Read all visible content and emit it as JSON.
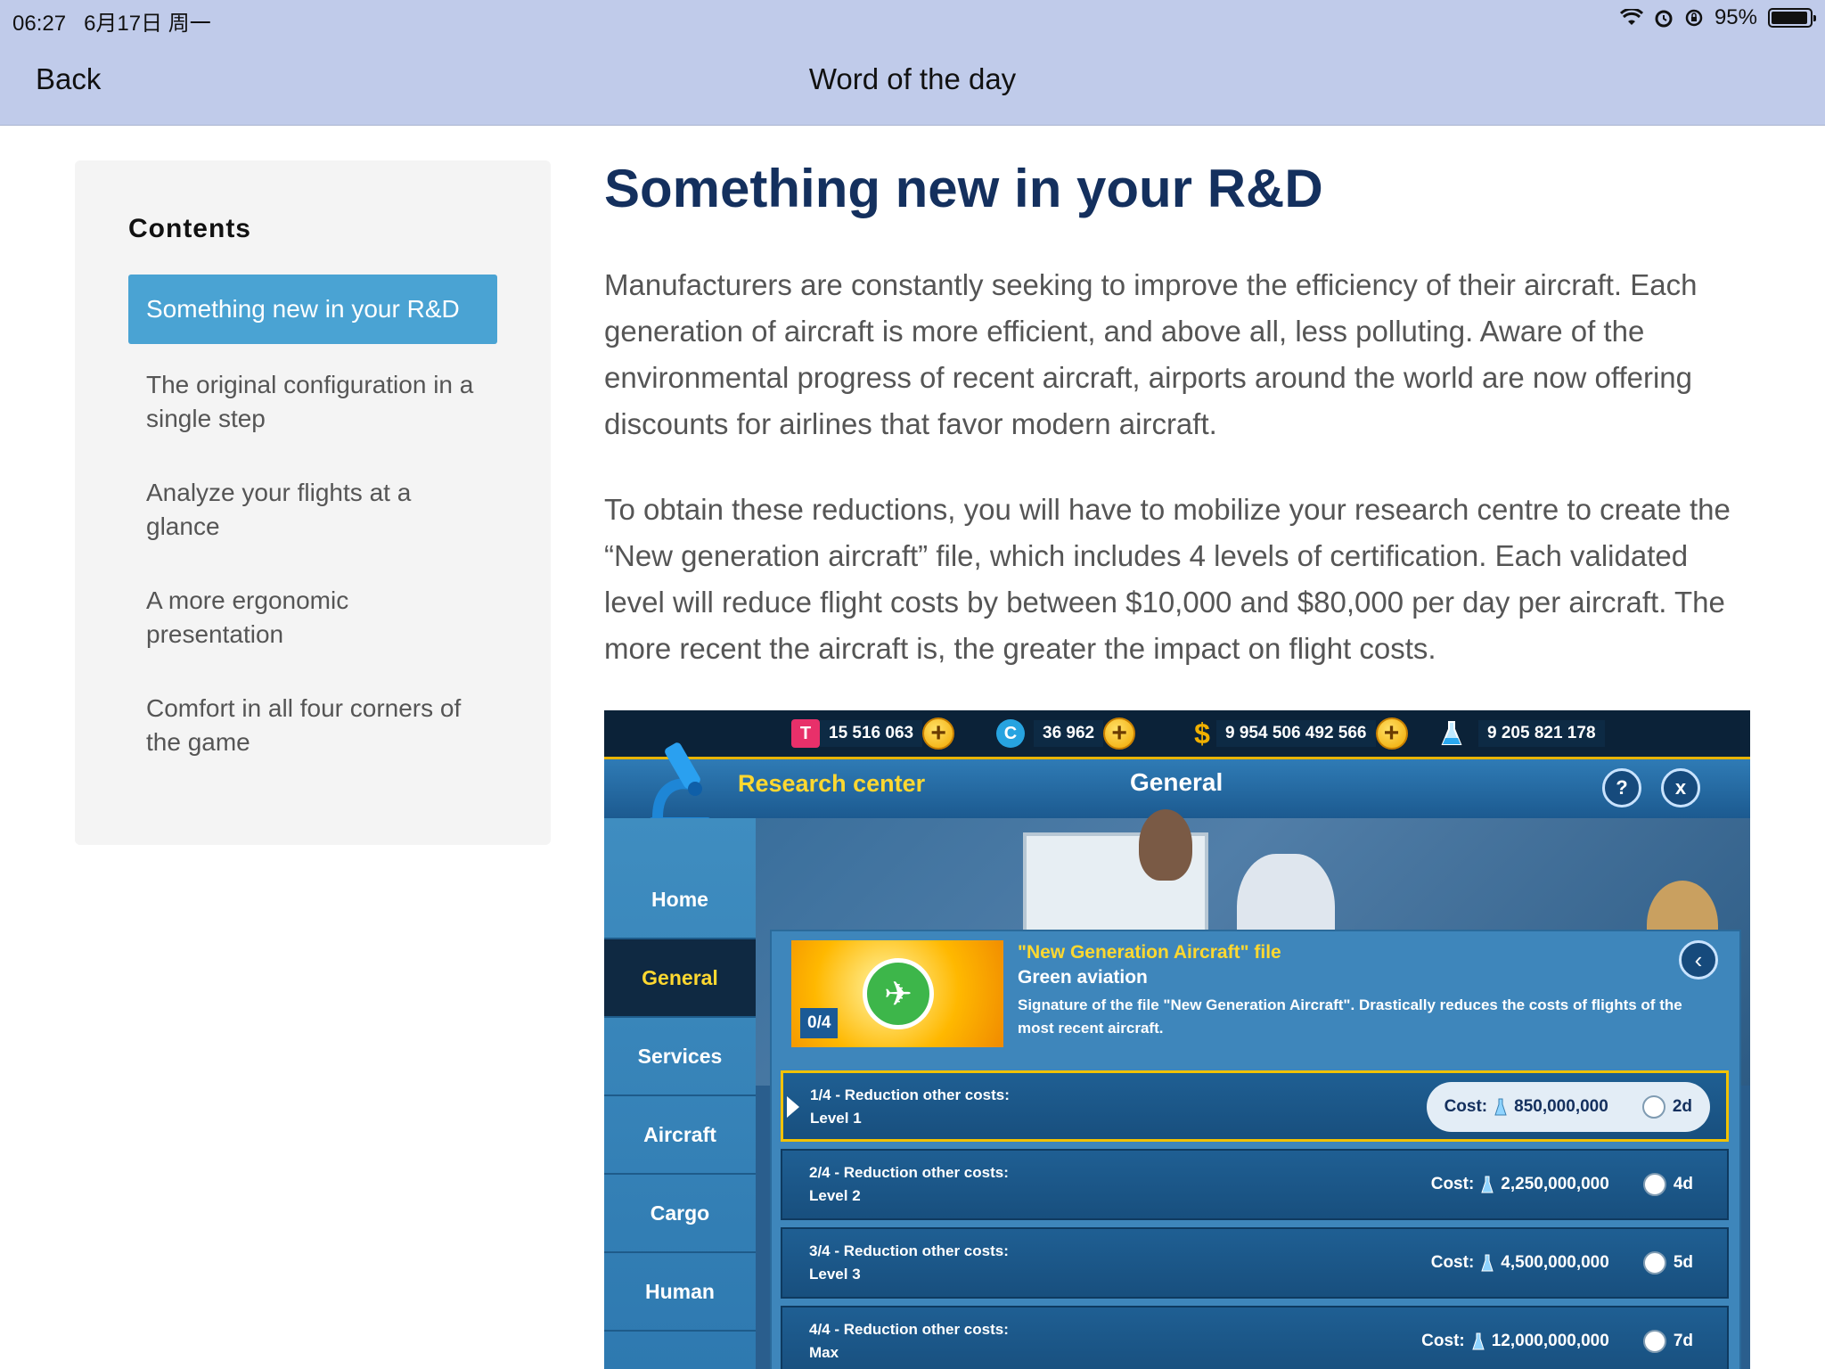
{
  "status_bar": {
    "time": "06:27",
    "date": "6月17日 周一",
    "battery": "95%",
    "battery_level": 0.95
  },
  "nav": {
    "back_label": "Back",
    "title": "Word of the day"
  },
  "toc": {
    "heading": "Contents",
    "items": [
      {
        "label": "Something new in your R&D",
        "active": true
      },
      {
        "label": "The original configuration in a single step"
      },
      {
        "label": "Analyze your flights at a glance"
      },
      {
        "label": "A more ergonomic presentation"
      },
      {
        "label": "Comfort in all four corners of the game"
      }
    ]
  },
  "article": {
    "title": "Something new in your R&D",
    "paragraphs": [
      "Manufacturers are constantly seeking to improve the efficiency of their aircraft. Each generation of aircraft is more efficient, and above all, less polluting. Aware of the environmental progress of recent aircraft, airports around the world are now offering discounts for airlines that favor modern aircraft.",
      "To obtain these reductions, you will have to mobilize your research centre to create the “New generation aircraft” file, which includes 4 levels of certification. Each validated level will reduce flight costs by between $10,000 and $80,000 per day per aircraft. The more recent the aircraft is, the greater the impact on flight costs."
    ]
  },
  "game": {
    "resources": {
      "tickets": "15 516 063",
      "coins": "36 962",
      "dollars": "9 954 506 492 566",
      "research": "9 205 821 178"
    },
    "header": {
      "section": "Research center",
      "tab": "General",
      "help": "?",
      "close": "x"
    },
    "menu": [
      "Home",
      "General",
      "Services",
      "Aircraft",
      "Cargo",
      "Human"
    ],
    "file": {
      "progress": "0/4",
      "title": "\"New Generation Aircraft\" file",
      "subtitle": "Green aviation",
      "description": "Signature of the file \"New Generation Aircraft\". Drastically reduces the costs of flights of the most recent aircraft."
    },
    "cost_label": "Cost:",
    "levels": [
      {
        "name": "1/4 - Reduction other costs:",
        "level": "Level 1",
        "cost": "850,000,000",
        "time": "2d"
      },
      {
        "name": "2/4 - Reduction other costs:",
        "level": "Level 2",
        "cost": "2,250,000,000",
        "time": "4d"
      },
      {
        "name": "3/4 - Reduction other costs:",
        "level": "Level 3",
        "cost": "4,500,000,000",
        "time": "5d"
      },
      {
        "name": "4/4 - Reduction other costs:",
        "level": "Max",
        "cost": "12,000,000,000",
        "time": "7d"
      }
    ]
  }
}
